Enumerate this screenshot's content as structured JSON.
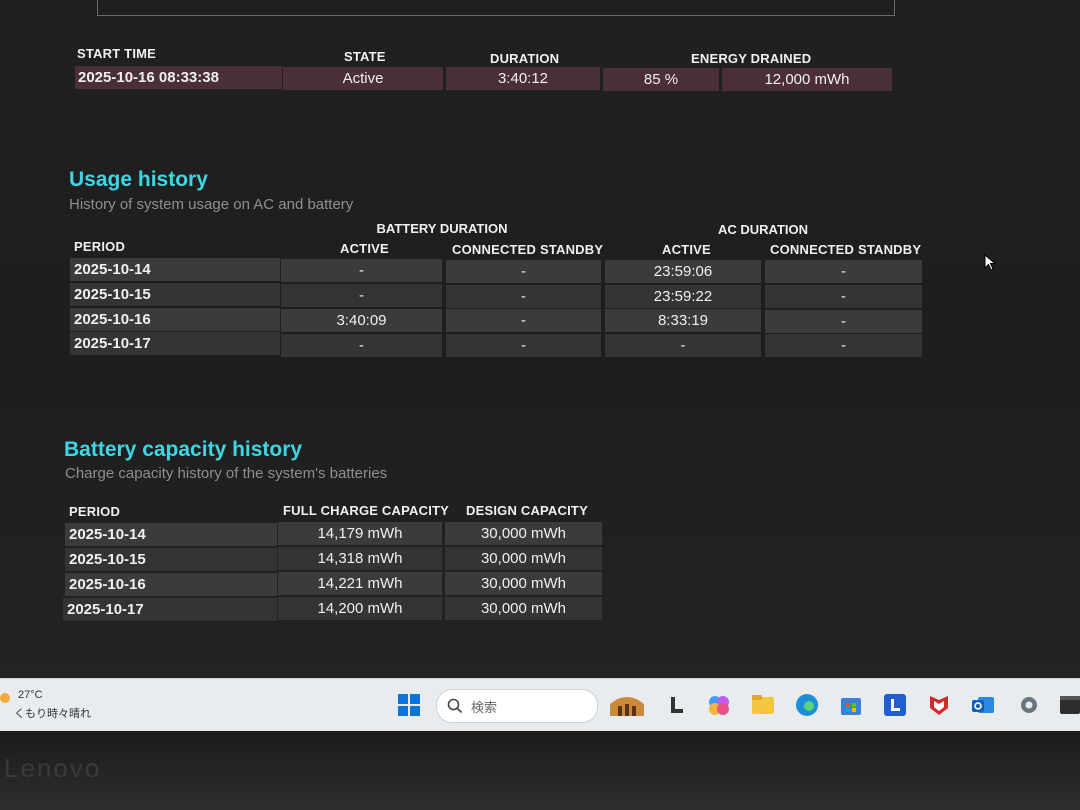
{
  "recent_session": {
    "headers": {
      "start_time": "START TIME",
      "state": "STATE",
      "duration": "DURATION",
      "energy_drained": "ENERGY DRAINED"
    },
    "row": {
      "start_time": "2025-10-16  08:33:38",
      "state": "Active",
      "duration": "3:40:12",
      "percent": "85 %",
      "mwh": "12,000 mWh"
    }
  },
  "usage_history": {
    "title": "Usage history",
    "subtitle": "History of system usage on AC and battery",
    "group_battery": "BATTERY DURATION",
    "group_ac": "AC DURATION",
    "col_period": "PERIOD",
    "col_b_active": "ACTIVE",
    "col_b_standby": "CONNECTED STANDBY",
    "col_ac_active": "ACTIVE",
    "col_ac_standby": "CONNECTED STANDBY",
    "rows": [
      {
        "period": "2025-10-14",
        "b_active": "-",
        "b_standby": "-",
        "ac_active": "23:59:06",
        "ac_standby": "-"
      },
      {
        "period": "2025-10-15",
        "b_active": "-",
        "b_standby": "-",
        "ac_active": "23:59:22",
        "ac_standby": "-"
      },
      {
        "period": "2025-10-16",
        "b_active": "3:40:09",
        "b_standby": "-",
        "ac_active": "8:33:19",
        "ac_standby": "-"
      },
      {
        "period": "2025-10-17",
        "b_active": "-",
        "b_standby": "-",
        "ac_active": "-",
        "ac_standby": "-"
      }
    ]
  },
  "capacity_history": {
    "title": "Battery capacity history",
    "subtitle": "Charge capacity history of the system's batteries",
    "col_period": "PERIOD",
    "col_full": "FULL CHARGE CAPACITY",
    "col_design": "DESIGN CAPACITY",
    "rows": [
      {
        "period": "2025-10-14",
        "full": "14,179 mWh",
        "design": "30,000 mWh"
      },
      {
        "period": "2025-10-15",
        "full": "14,318 mWh",
        "design": "30,000 mWh"
      },
      {
        "period": "2025-10-16",
        "full": "14,221 mWh",
        "design": "30,000 mWh"
      },
      {
        "period": "2025-10-17",
        "full": "14,200 mWh",
        "design": "30,000 mWh"
      }
    ]
  },
  "taskbar": {
    "temperature": "27°C",
    "weather": "くもり時々晴れ",
    "search_placeholder": "検索",
    "icons": [
      "windows-start-icon",
      "search-icon",
      "game-icon",
      "launcher-icon",
      "copilot-icon",
      "file-explorer-icon",
      "edge-icon",
      "store-icon",
      "lenovo-icon",
      "mcafee-icon",
      "outlook-icon",
      "settings-icon",
      "terminal-icon"
    ]
  },
  "bezel": {
    "brand": "Lenovo"
  }
}
